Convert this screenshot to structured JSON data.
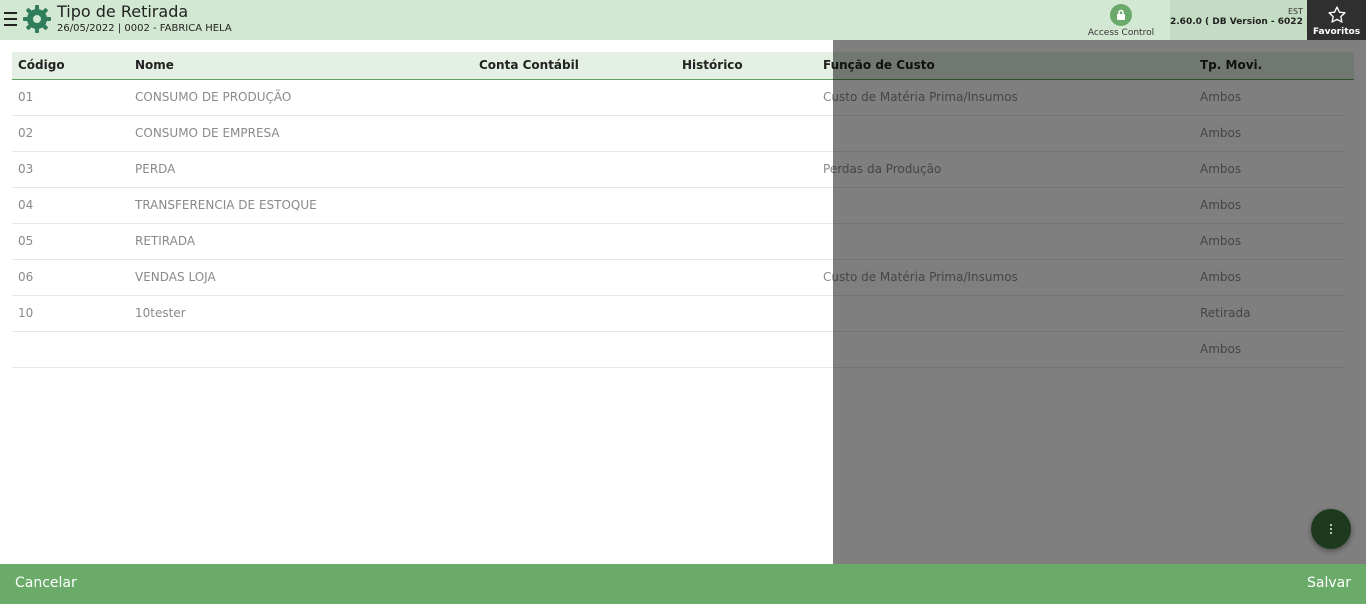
{
  "header": {
    "title": "Tipo de Retirada",
    "subtitle": "26/05/2022 | 0002 - FABRICA HELA",
    "access_control_label": "Access Control",
    "env_label": "EST",
    "version_label": "2.60.0 ( DB Version - 6022 )",
    "favorites_label": "Favoritos"
  },
  "table": {
    "columns": [
      "Código",
      "Nome",
      "Conta Contábil",
      "Histórico",
      "Função de Custo",
      "Tp. Movi."
    ],
    "rows": [
      {
        "codigo": "01",
        "nome": "CONSUMO DE PRODUÇÃO",
        "conta": "",
        "historico": "",
        "funcao": "Custo de Matéria Prima/Insumos",
        "tp": "Ambos"
      },
      {
        "codigo": "02",
        "nome": "CONSUMO DE EMPRESA",
        "conta": "",
        "historico": "",
        "funcao": "",
        "tp": "Ambos"
      },
      {
        "codigo": "03",
        "nome": "PERDA",
        "conta": "",
        "historico": "",
        "funcao": "Perdas da Produção",
        "tp": "Ambos"
      },
      {
        "codigo": "04",
        "nome": "TRANSFERENCIA DE ESTOQUE",
        "conta": "",
        "historico": "",
        "funcao": "",
        "tp": "Ambos"
      },
      {
        "codigo": "05",
        "nome": "RETIRADA",
        "conta": "",
        "historico": "",
        "funcao": "",
        "tp": "Ambos"
      },
      {
        "codigo": "06",
        "nome": "VENDAS LOJA",
        "conta": "",
        "historico": "",
        "funcao": "Custo de Matéria Prima/Insumos",
        "tp": "Ambos"
      },
      {
        "codigo": "10",
        "nome": "10tester",
        "conta": "",
        "historico": "",
        "funcao": "",
        "tp": "Retirada"
      },
      {
        "codigo": "",
        "nome": "",
        "conta": "",
        "historico": "",
        "funcao": "",
        "tp": "Ambos"
      }
    ]
  },
  "footer": {
    "cancel_label": "Cancelar",
    "save_label": "Salvar"
  },
  "icons": {
    "menu": "hamburger-icon",
    "logo": "gear-logo-icon",
    "access": "lock-icon",
    "favorites": "star-icon",
    "fab": "more-vertical-icon"
  },
  "colors": {
    "topbar": "#d2e8d2",
    "footer": "#6aab6a",
    "accent": "#5f9f5f",
    "favorites_bg": "#2f2f2f"
  }
}
